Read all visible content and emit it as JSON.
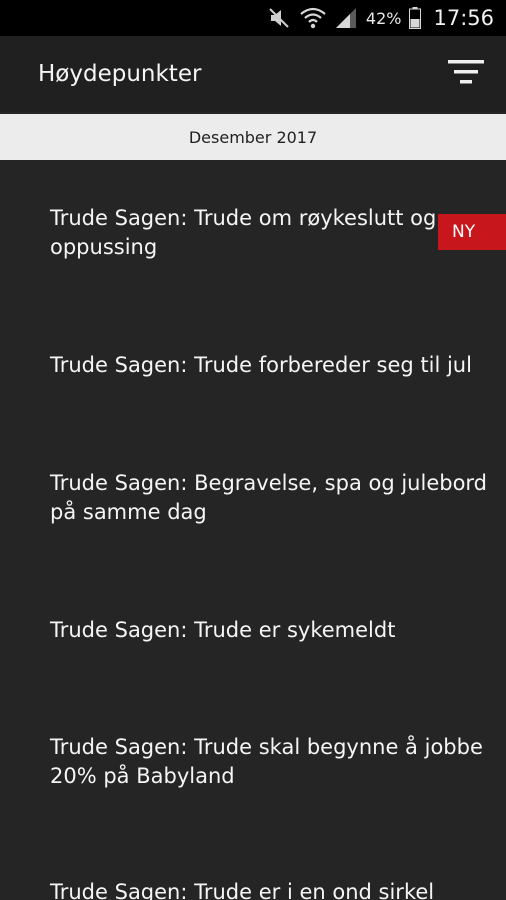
{
  "status_bar": {
    "icons": [
      "mute-icon",
      "wifi-icon",
      "signal-icon",
      "battery-icon"
    ],
    "battery_percent": "42%",
    "time": "17:56"
  },
  "app_bar": {
    "title": "Høydepunkter",
    "filter_icon": "filter-icon"
  },
  "section": {
    "label": "Desember 2017"
  },
  "items": [
    {
      "title": "Trude Sagen: Trude om røykeslutt og\noppussing",
      "badge": "NY"
    },
    {
      "title": "Trude Sagen: Trude forbereder seg til jul"
    },
    {
      "title": "Trude Sagen: Begravelse, spa og julebord\npå samme dag"
    },
    {
      "title": "Trude Sagen: Trude er sykemeldt"
    },
    {
      "title": "Trude Sagen: Trude skal begynne å jobbe\n20% på Babyland"
    },
    {
      "title": "Trude Sagen: Trude er i en ond sirkel"
    }
  ],
  "colors": {
    "background": "#252525",
    "app_bar": "#202020",
    "section_header": "#ececec",
    "badge": "#c8161d"
  }
}
